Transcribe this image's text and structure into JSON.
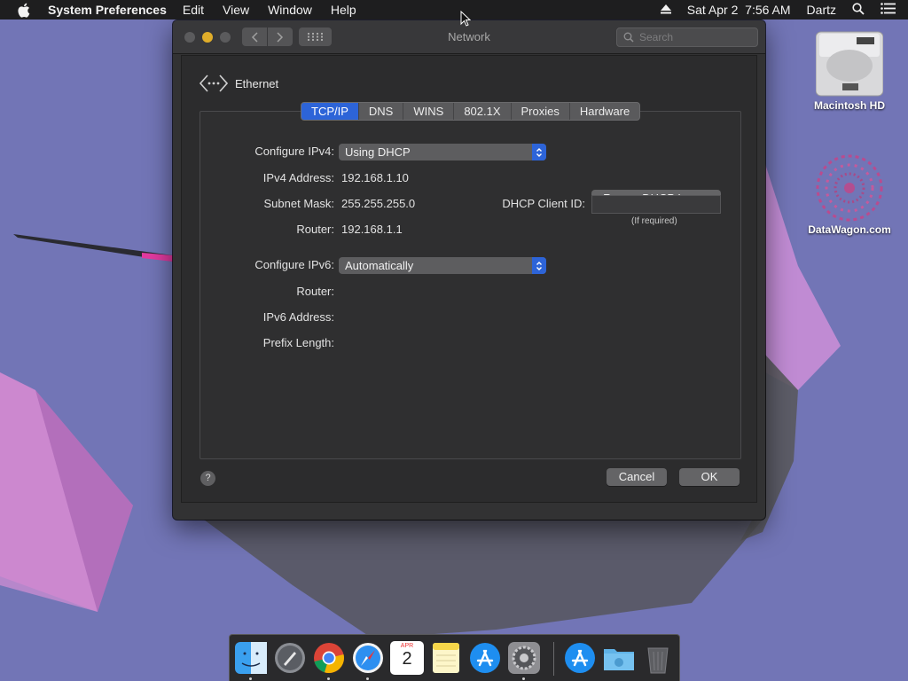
{
  "menubar": {
    "app_name": "System Preferences",
    "menus": [
      "Edit",
      "View",
      "Window",
      "Help"
    ],
    "datetime": "Sat Apr 2  7:56 AM",
    "user": "Dartz"
  },
  "window": {
    "title": "Network",
    "search_placeholder": "Search",
    "interface_name": "Ethernet",
    "tabs": [
      "TCP/IP",
      "DNS",
      "WINS",
      "802.1X",
      "Proxies",
      "Hardware"
    ],
    "active_tab": "TCP/IP",
    "tcpip": {
      "configure_ipv4_label": "Configure IPv4:",
      "configure_ipv4_value": "Using DHCP",
      "ipv4_address_label": "IPv4 Address:",
      "ipv4_address_value": "192.168.1.10",
      "subnet_mask_label": "Subnet Mask:",
      "subnet_mask_value": "255.255.255.0",
      "router_label": "Router:",
      "router_value": "192.168.1.1",
      "renew_button": "Renew DHCP Lease",
      "dhcp_client_id_label": "DHCP Client ID:",
      "dhcp_client_id_value": "",
      "dhcp_client_id_hint": "(If required)",
      "configure_ipv6_label": "Configure IPv6:",
      "configure_ipv6_value": "Automatically",
      "ipv6_router_label": "Router:",
      "ipv6_address_label": "IPv6 Address:",
      "prefix_length_label": "Prefix Length:"
    },
    "help_label": "?",
    "cancel_button": "Cancel",
    "ok_button": "OK"
  },
  "desktop": {
    "icons": [
      "Macintosh HD",
      "DataWagon.com"
    ]
  },
  "dock": {
    "apps": [
      "Finder",
      "Launchpad",
      "Chrome",
      "Safari",
      "Calendar",
      "Notes",
      "App Store",
      "System Preferences",
      "App Store Downloads",
      "Downloads Folder",
      "Trash"
    ],
    "calendar_month": "APR",
    "calendar_day": "2"
  },
  "colors": {
    "accent": "#2d64d8",
    "wallpaper": "#7275b6",
    "window_bg": "#323233"
  }
}
